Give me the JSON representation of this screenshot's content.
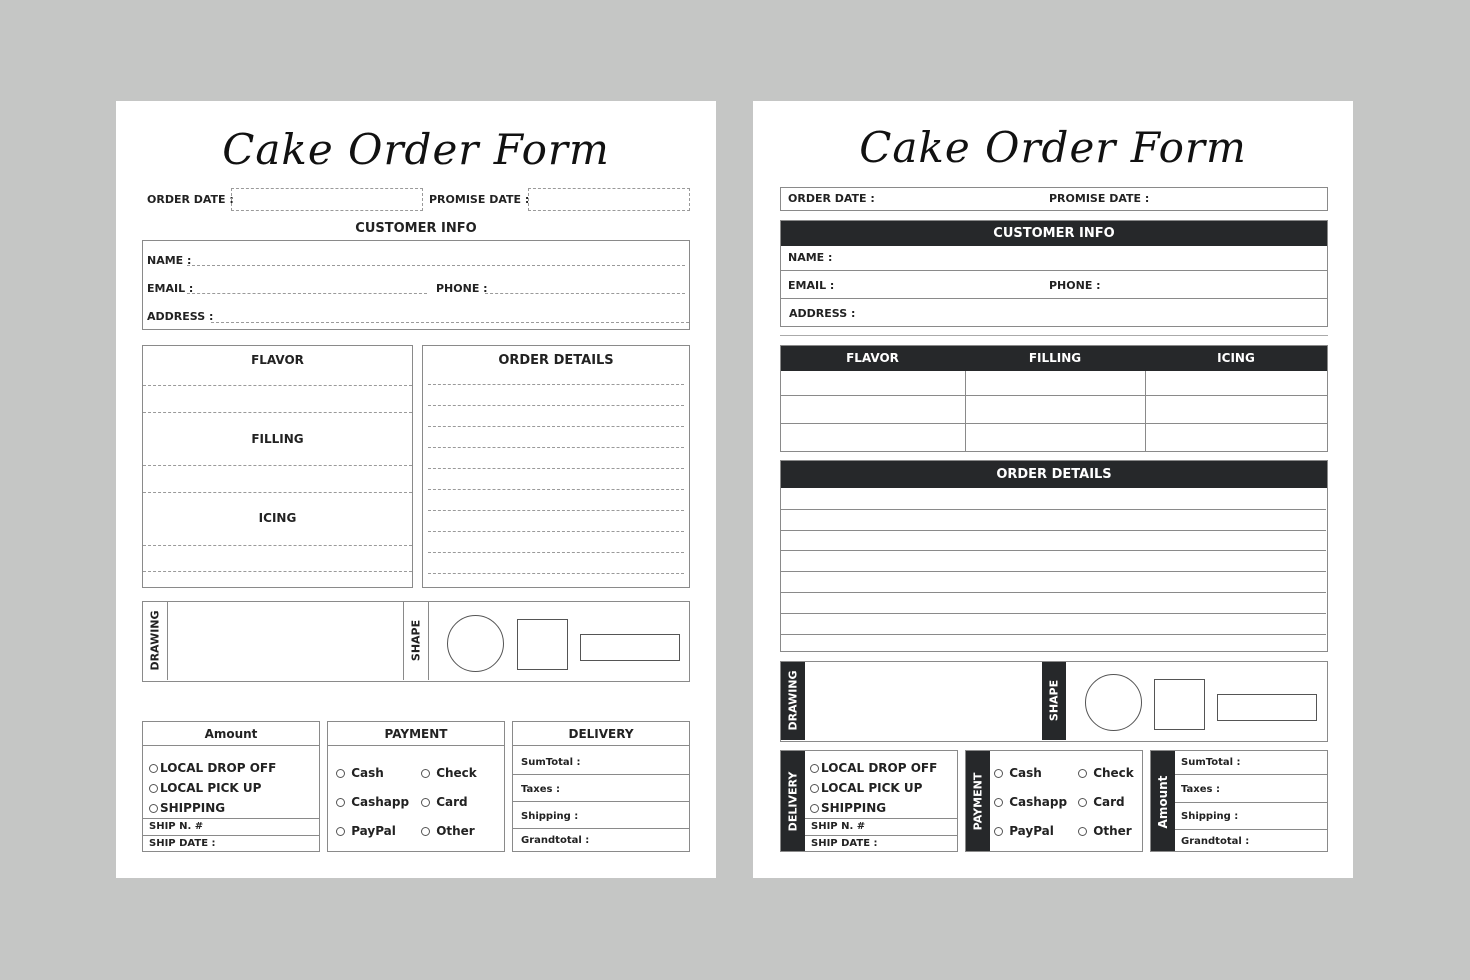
{
  "colors": {
    "background": "#c5c6c5",
    "page": "#ffffff",
    "header_dark": "#26282a",
    "line": "#8a8a8a"
  },
  "pages": [
    {
      "variant": "outline-dashed",
      "title": "Cake Order Form",
      "order_date_label": "ORDER DATE :",
      "promise_date_label": "PROMISE DATE :",
      "customer_info": {
        "heading": "CUSTOMER INFO",
        "name_label": "NAME :",
        "email_label": "EMAIL :",
        "phone_label": "PHONE :",
        "address_label": "ADDRESS :"
      },
      "cake": {
        "flavor": "FLAVOR",
        "filling": "FILLING",
        "icing": "ICING"
      },
      "order_details": {
        "heading": "ORDER DETAILS",
        "line_count": 10
      },
      "drawing_label": "DRAWING",
      "shape_label": "SHAPE",
      "shapes": [
        "circle",
        "square",
        "rectangle"
      ],
      "amount": {
        "heading": "Amount",
        "options": [
          "LOCAL DROP OFF",
          "LOCAL PICK UP",
          "SHIPPING"
        ],
        "ship_no": "SHIP N. #",
        "ship_date": "SHIP DATE :"
      },
      "payment": {
        "heading": "PAYMENT",
        "options": [
          "Cash",
          "Check",
          "Cashapp",
          "Card",
          "PayPal",
          "Other"
        ]
      },
      "delivery": {
        "heading": "DELIVERY",
        "rows": [
          "SumTotal :",
          "Taxes :",
          "Shipping :",
          "Grandtotal :"
        ]
      }
    },
    {
      "variant": "filled-header",
      "title": "Cake Order Form",
      "order_date_label": "ORDER DATE :",
      "promise_date_label": "PROMISE DATE :",
      "customer_info": {
        "heading": "CUSTOMER INFO",
        "name_label": "NAME :",
        "email_label": "EMAIL :",
        "phone_label": "PHONE :",
        "address_label": "ADDRESS :"
      },
      "cake": {
        "flavor": "FLAVOR",
        "filling": "FILLING",
        "icing": "ICING",
        "row_count": 3
      },
      "order_details": {
        "heading": "ORDER DETAILS",
        "line_count": 8
      },
      "drawing_label": "DRAWING",
      "shape_label": "SHAPE",
      "shapes": [
        "circle",
        "square",
        "rectangle"
      ],
      "delivery": {
        "heading": "DELIVERY",
        "options": [
          "LOCAL DROP OFF",
          "LOCAL PICK UP",
          "SHIPPING"
        ],
        "ship_no": "SHIP N. #",
        "ship_date": "SHIP DATE :"
      },
      "payment": {
        "heading": "PAYMENT",
        "options": [
          "Cash",
          "Check",
          "Cashapp",
          "Card",
          "PayPal",
          "Other"
        ]
      },
      "amount": {
        "heading": "Amount",
        "rows": [
          "SumTotal :",
          "Taxes :",
          "Shipping :",
          "Grandtotal :"
        ]
      }
    }
  ]
}
